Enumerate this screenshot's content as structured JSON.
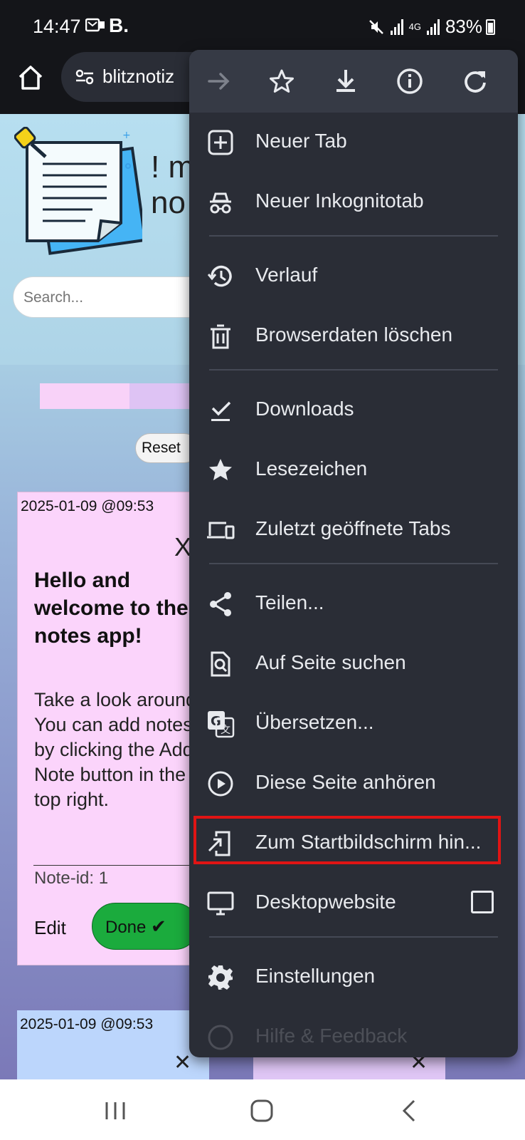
{
  "status_bar": {
    "time": "14:47",
    "app_label": "B.",
    "network": "4G",
    "battery": "83%"
  },
  "browser": {
    "url_text": "blitznotiz"
  },
  "page": {
    "title_fragment_1": "! m",
    "title_fragment_2": "no",
    "search_placeholder": "Search...",
    "reset_label": "Reset",
    "swatches": [
      "#f8d2f8",
      "#dec3f4"
    ],
    "note1": {
      "date": "2025-01-09 @09:53",
      "close": "X",
      "title": "Hello and welcome to the notes app!",
      "body": "Take a look around. You can add notes by clicking the Add Note button in the top right.",
      "note_id": "Note-id: 1",
      "edit_label": "Edit",
      "done_label": "Done",
      "done_check": "✔"
    },
    "note2": {
      "date": "2025-01-09 @09:53"
    }
  },
  "menu": {
    "items": [
      {
        "label": "Neuer Tab",
        "icon": "new-tab-icon"
      },
      {
        "label": "Neuer Inkognitotab",
        "icon": "incognito-icon"
      },
      {
        "label": "Verlauf",
        "icon": "history-icon"
      },
      {
        "label": "Browserdaten löschen",
        "icon": "trash-icon"
      },
      {
        "label": "Downloads",
        "icon": "downloads-check-icon"
      },
      {
        "label": "Lesezeichen",
        "icon": "star-filled-icon"
      },
      {
        "label": "Zuletzt geöffnete Tabs",
        "icon": "devices-icon"
      },
      {
        "label": "Teilen...",
        "icon": "share-icon"
      },
      {
        "label": "Auf Seite suchen",
        "icon": "find-in-page-icon"
      },
      {
        "label": "Übersetzen...",
        "icon": "translate-icon"
      },
      {
        "label": "Diese Seite anhören",
        "icon": "play-circle-icon"
      },
      {
        "label": "Zum Startbildschirm hin...",
        "icon": "add-to-home-icon"
      },
      {
        "label": "Desktopwebsite",
        "icon": "desktop-icon"
      },
      {
        "label": "Einstellungen",
        "icon": "gear-icon"
      },
      {
        "label": "Hilfe & Feedback",
        "icon": "help-icon"
      }
    ],
    "highlight_color": "#e01414"
  }
}
